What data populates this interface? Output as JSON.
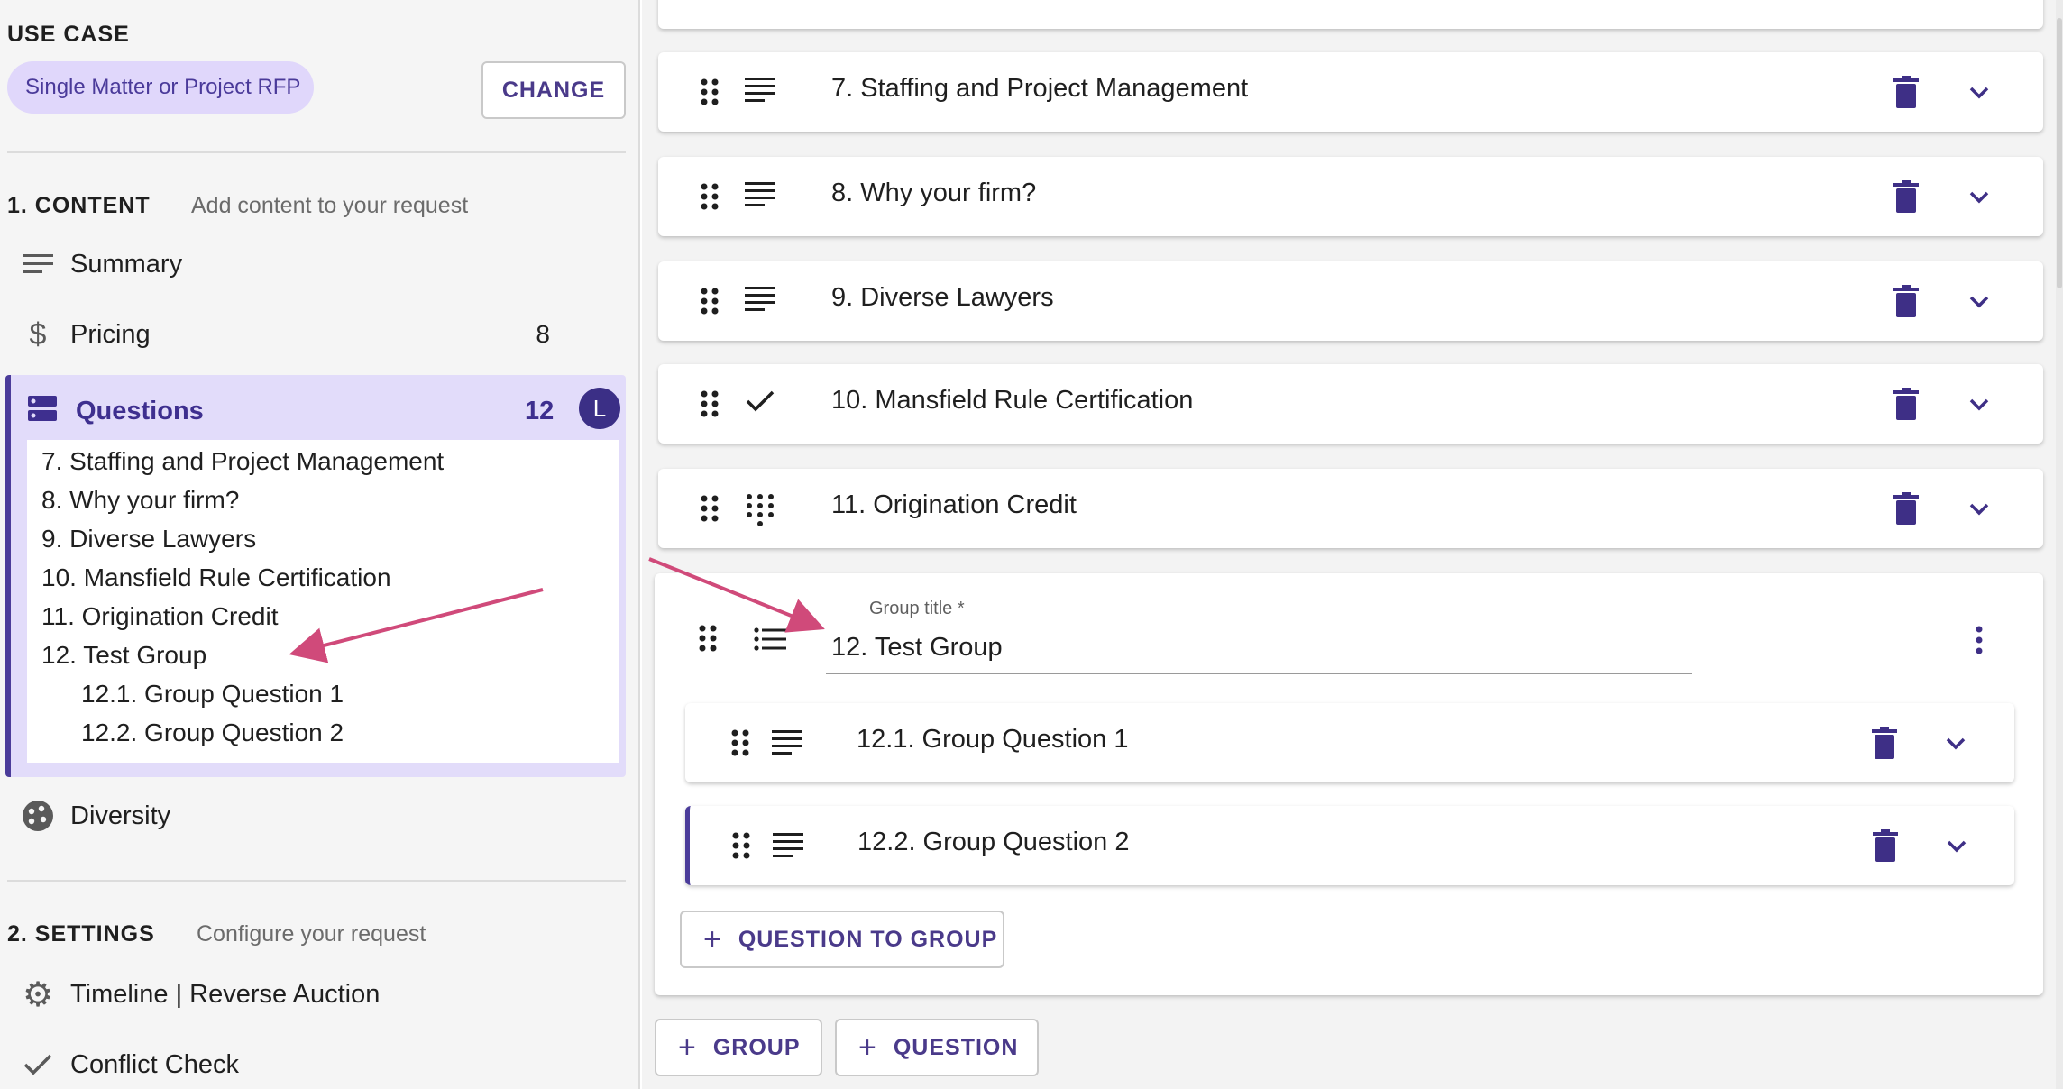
{
  "sidebar": {
    "use_case_label": "USE CASE",
    "use_case_value": "Single Matter or Project RFP",
    "change_label": "CHANGE",
    "content_section": {
      "label": "1. CONTENT",
      "hint": "Add content to your request"
    },
    "items": [
      {
        "label": "Summary",
        "icon": "lines-icon",
        "count": ""
      },
      {
        "label": "Pricing",
        "icon": "dollar-icon",
        "count": "8"
      },
      {
        "label": "Questions",
        "icon": "storage-icon",
        "count": "12",
        "avatar": "L"
      },
      {
        "label": "Diversity",
        "icon": "palette-icon",
        "count": ""
      }
    ],
    "question_list": [
      "7. Staffing and Project Management",
      "8. Why your firm?",
      "9. Diverse Lawyers",
      "10. Mansfield Rule Certification",
      "11. Origination Credit",
      "12. Test Group",
      "12.1. Group Question 1",
      "12.2. Group Question 2"
    ],
    "settings_section": {
      "label": "2. SETTINGS",
      "hint": "Configure your request"
    },
    "settings_items": [
      {
        "label": "Timeline | Reverse Auction",
        "icon": "gear-icon"
      },
      {
        "label": "Conflict Check",
        "icon": "check-icon"
      }
    ]
  },
  "main": {
    "questions": [
      {
        "title": "7. Staffing and Project Management",
        "icon": "text-icon"
      },
      {
        "title": "8. Why your firm?",
        "icon": "text-icon"
      },
      {
        "title": "9. Diverse Lawyers",
        "icon": "text-icon"
      },
      {
        "title": "10. Mansfield Rule Certification",
        "icon": "check-icon"
      },
      {
        "title": "11. Origination Credit",
        "icon": "dialpad-icon"
      }
    ],
    "group": {
      "field_label": "Group title *",
      "title": "12. Test Group",
      "children": [
        {
          "title": "12.1. Group Question 1"
        },
        {
          "title": "12.2. Group Question 2"
        }
      ],
      "add_question_label": "QUESTION TO GROUP"
    },
    "add_group_label": "GROUP",
    "add_question_label": "QUESTION"
  },
  "colors": {
    "accent": "#4b3c9a",
    "accent_light": "#e2dcfa",
    "annotation_arrow": "#d04a7a"
  }
}
